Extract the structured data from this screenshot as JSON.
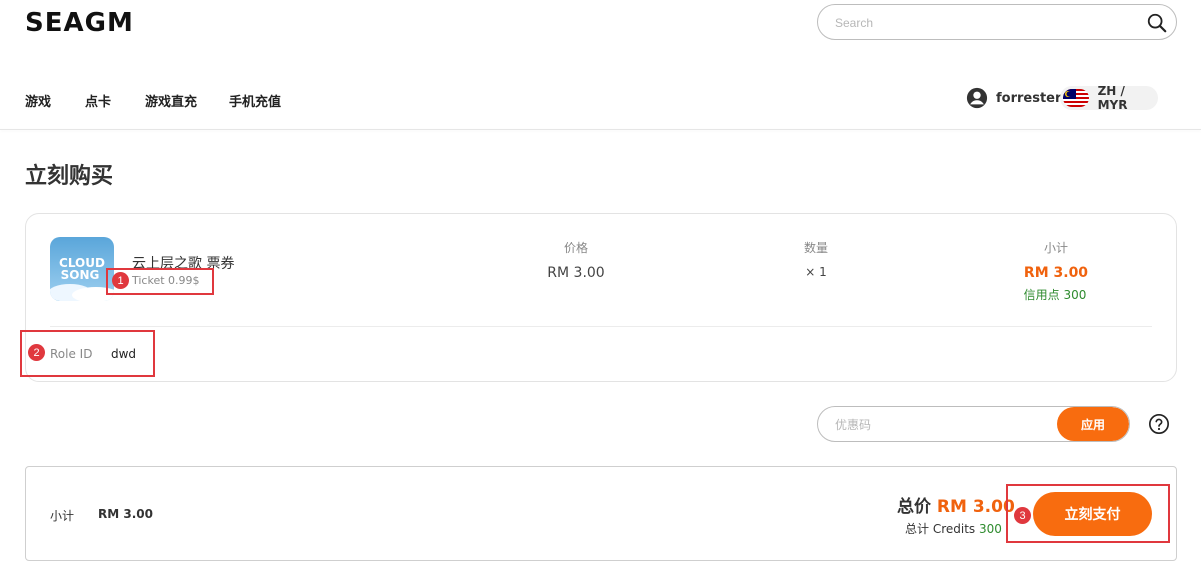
{
  "header": {
    "logo": "SEAGM",
    "search_placeholder": "Search",
    "nav": [
      "游戏",
      "点卡",
      "游戏直充",
      "手机充值"
    ],
    "username": "forrester",
    "locale": "ZH / MYR"
  },
  "page": {
    "title": "立刻购买"
  },
  "product": {
    "name": "云上层之歌 票券",
    "variant": "Ticket 0.99$",
    "price_label": "价格",
    "price": "RM 3.00",
    "qty_label": "数量",
    "qty": "× 1",
    "subtotal_label": "小计",
    "subtotal": "RM 3.00",
    "credit_label": "信用点",
    "credit_value": "300",
    "role_label": "Role ID",
    "role_value": "dwd",
    "thumbnail_text": [
      "CLOUD",
      "SONG"
    ]
  },
  "coupon": {
    "placeholder": "优惠码",
    "apply_label": "应用"
  },
  "summary": {
    "subtotal_label": "小计",
    "subtotal_value": "RM 3.00",
    "total_label": "总价",
    "total_value": "RM 3.00",
    "credits_label": "总计 Credits",
    "credits_value": "300",
    "pay_label": "立刻支付"
  },
  "annotations": [
    "1",
    "2",
    "3"
  ],
  "colors": {
    "accent": "#f86c0f",
    "price": "#f0620e",
    "credit": "#2e8b2e",
    "annotation": "#e0383e"
  }
}
